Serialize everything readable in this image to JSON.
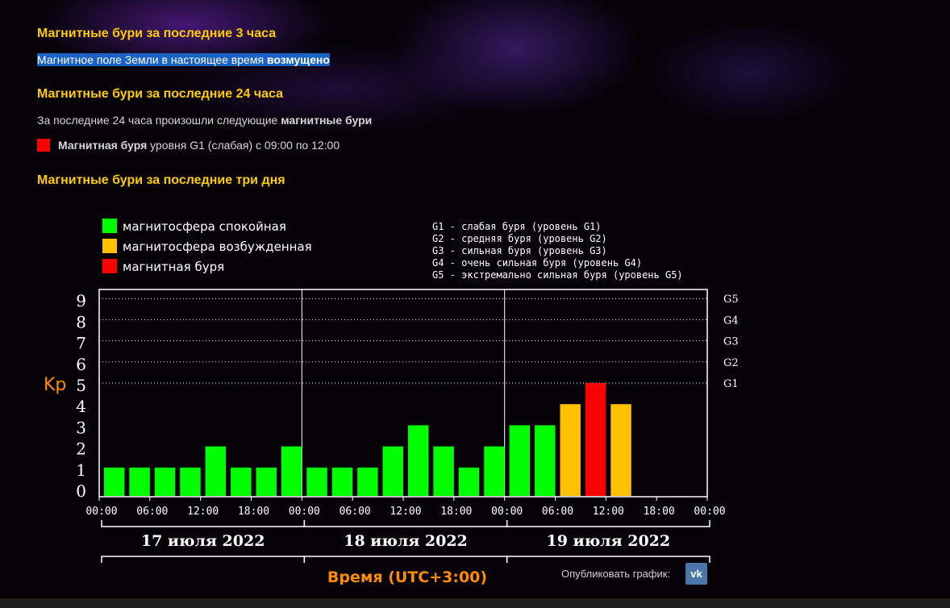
{
  "sections": {
    "last3h": {
      "title": "Магнитные бури за последние 3 часа",
      "text": "Магнитное поле Земли в настоящее время ",
      "status": "возмущено"
    },
    "last24h": {
      "title": "Магнитные бури за последние 24 часа",
      "intro": "За последние 24 часа произошли следующие ",
      "intro_bold": "магнитные бури",
      "event_bold": "Магнитная буря",
      "event_text": " уровня G1 (слабая) с 09:00 по 12:00"
    },
    "last3d": {
      "title": "Магнитные бури за последние три дня"
    }
  },
  "chart_data": {
    "type": "bar",
    "ylabel": "Kp",
    "xlabel": "Время (UTC+3:00)",
    "ylim": [
      0,
      9
    ],
    "y_ticks": [
      "0",
      "1",
      "2",
      "3",
      "4",
      "5",
      "6",
      "7",
      "8",
      "9"
    ],
    "g_levels": [
      {
        "label": "G1",
        "kp": 5
      },
      {
        "label": "G2",
        "kp": 6
      },
      {
        "label": "G3",
        "kp": 7
      },
      {
        "label": "G4",
        "kp": 8
      },
      {
        "label": "G5",
        "kp": 9
      }
    ],
    "legend_left": [
      {
        "label": "магнитосфера спокойная",
        "color": "#00ff00"
      },
      {
        "label": "магнитосфера возбужденная",
        "color": "#ffc000"
      },
      {
        "label": "магнитная буря",
        "color": "#ff0000"
      }
    ],
    "legend_right": [
      "G1 - слабая буря (уровень G1)",
      "G2 - средняя буря (уровень G2)",
      "G3 - сильная буря (уровень G3)",
      "G4 - очень сильная буря (уровень G4)",
      "G5 - экстремально сильная буря (уровень G5)"
    ],
    "time_ticks": [
      "00:00",
      "06:00",
      "12:00",
      "18:00",
      "00:00",
      "06:00",
      "12:00",
      "18:00",
      "00:00",
      "06:00",
      "12:00",
      "18:00",
      "00:00"
    ],
    "days": [
      "17 июля 2022",
      "18 июля 2022",
      "19 июля 2022"
    ],
    "values": [
      1,
      1,
      1,
      1,
      2,
      1,
      1,
      2,
      1,
      1,
      1,
      2,
      3,
      2,
      1,
      2,
      3,
      3,
      4,
      5,
      4
    ],
    "colors": {
      "quiet": "#00ff00",
      "active": "#ffc000",
      "storm": "#ff0000"
    }
  },
  "publish_label": "Опубликовать график:",
  "vk_icon_text": "vk"
}
